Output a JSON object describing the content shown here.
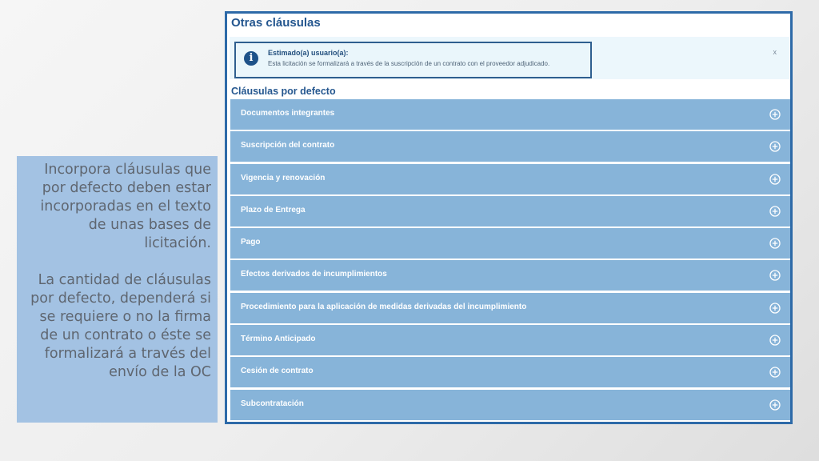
{
  "description": {
    "paragraph1": "Incorpora cláusulas que por defecto deben estar incorporadas en el texto de unas bases de licitación.",
    "paragraph2": "La cantidad de cláusulas por defecto, dependerá si se requiere o no la firma de un contrato o éste se formalizará a través del envío de la OC"
  },
  "panel": {
    "title": "Otras cláusulas",
    "notice": {
      "icon": "info-icon",
      "title": "Estimado(a) usuario(a):",
      "text": "Esta licitación se formalizará a través de la suscripción de un contrato con el proveedor adjudicado.",
      "close": "x"
    },
    "section_heading": "Cláusulas por defecto",
    "clauses": [
      {
        "label": "Documentos integrantes",
        "icon": "plus-circle-icon"
      },
      {
        "label": "Suscripción del contrato",
        "icon": "plus-circle-icon"
      },
      {
        "label": "Vigencia y renovación",
        "icon": "plus-circle-icon"
      },
      {
        "label": "Plazo de Entrega",
        "icon": "plus-circle-icon"
      },
      {
        "label": "Pago",
        "icon": "plus-circle-icon"
      },
      {
        "label": "Efectos derivados de incumplimientos",
        "icon": "plus-circle-icon"
      },
      {
        "label": "Procedimiento para la aplicación de medidas derivadas del incumplimiento",
        "icon": "plus-circle-icon"
      },
      {
        "label": "Término Anticipado",
        "icon": "plus-circle-icon"
      },
      {
        "label": "Cesión de contrato",
        "icon": "plus-circle-icon"
      },
      {
        "label": "Subcontratación",
        "icon": "plus-circle-icon"
      }
    ]
  },
  "colors": {
    "accent": "#25578f",
    "clause_bar": "#87b4d9",
    "description_bg": "#a3c2e3",
    "panel_border": "#2d6aa8"
  }
}
